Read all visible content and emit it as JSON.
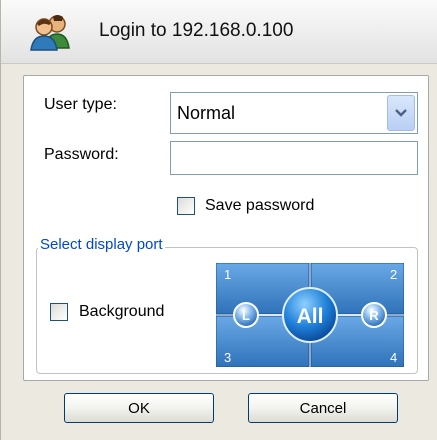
{
  "window": {
    "title": "Login to 192.168.0.100",
    "icon": "users-icon"
  },
  "form": {
    "user_type_label": "User type:",
    "user_type_value": "Normal",
    "password_label": "Password:",
    "password_value": "",
    "save_password_label": "Save password",
    "save_password_checked": false
  },
  "display_port": {
    "legend": "Select display port",
    "background_label": "Background",
    "background_checked": false,
    "quadrants": [
      "1",
      "2",
      "3",
      "4"
    ],
    "left_button": "L",
    "center_button": "All",
    "right_button": "R"
  },
  "buttons": {
    "ok": "OK",
    "cancel": "Cancel"
  },
  "colors": {
    "accent": "#0046d5",
    "port_blue": "#3d84c9",
    "button_border": "#003c74"
  }
}
